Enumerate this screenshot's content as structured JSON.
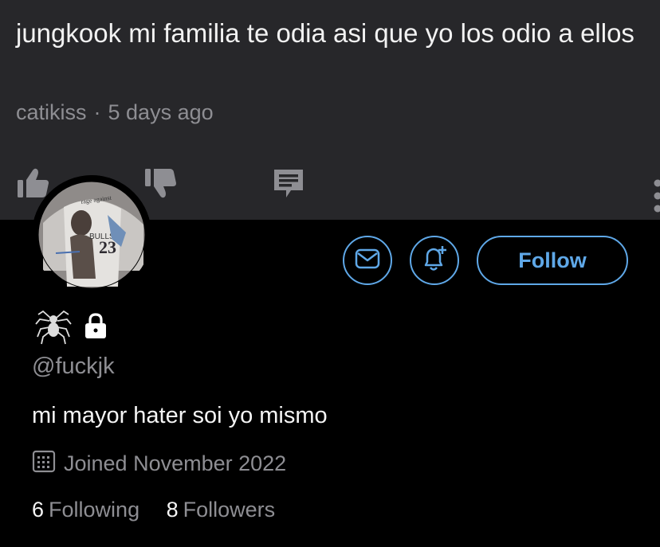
{
  "comment": {
    "text": "jungkook mi familia te odia asi que yo los odio a ellos",
    "author": "catikiss",
    "separator": "·",
    "time": "5 days ago",
    "actions": [
      "like-icon",
      "dislike-icon",
      "reply-icon",
      "more-icon"
    ]
  },
  "profile": {
    "avatar": "avatar",
    "display_name_icons": [
      "spider-icon",
      "lock-icon"
    ],
    "handle": "@fuckjk",
    "bio": "mi mayor hater soi yo mismo",
    "joined": "Joined November 2022",
    "following_count": "6",
    "following_label": "Following",
    "followers_count": "8",
    "followers_label": "Followers",
    "follow_label": "Follow",
    "accent_color": "#5fa8e8"
  }
}
